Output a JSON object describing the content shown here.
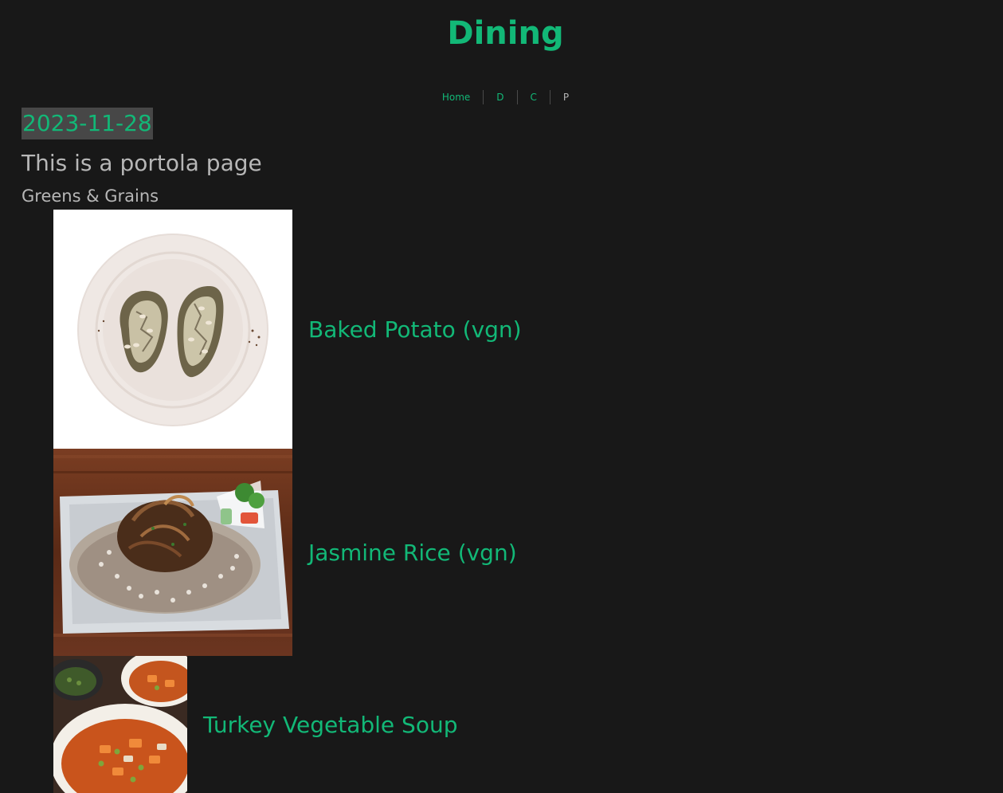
{
  "header": {
    "title": "Dining"
  },
  "nav": {
    "items": [
      {
        "label": "Home"
      },
      {
        "label": "D"
      },
      {
        "label": "C"
      },
      {
        "label": "P"
      }
    ]
  },
  "page": {
    "date": "2023-11-28",
    "subtitle": "This is a portola page",
    "category": "Greens & Grains"
  },
  "menu": {
    "items": [
      {
        "name": "Baked Potato (vgn)",
        "image": "baked-potato-photo"
      },
      {
        "name": "Jasmine Rice (vgn)",
        "image": "jasmine-rice-photo"
      },
      {
        "name": "Turkey Vegetable Soup",
        "image": "turkey-vegetable-soup-photo"
      }
    ]
  },
  "colors": {
    "background": "#181818",
    "accent": "#12b877",
    "text_muted": "#b7b7b7",
    "badge_bg": "#474747"
  }
}
